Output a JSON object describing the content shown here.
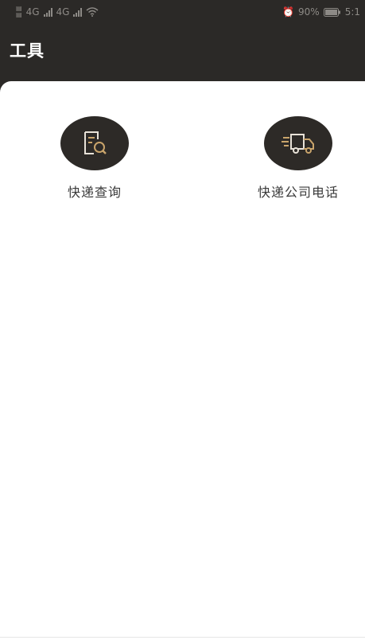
{
  "status_bar": {
    "network_left": "4G",
    "network_right": "4G",
    "battery": "90%",
    "time": "5:1"
  },
  "header": {
    "title": "工具"
  },
  "tools": [
    {
      "label": "快递查询",
      "icon": "document-search-icon"
    },
    {
      "label": "快递公司电话",
      "icon": "delivery-truck-icon"
    }
  ],
  "colors": {
    "header_bg": "#2b2927",
    "icon_circle": "#2d2a27",
    "icon_accent": "#c9a46b",
    "icon_line": "#e8e2d8"
  }
}
